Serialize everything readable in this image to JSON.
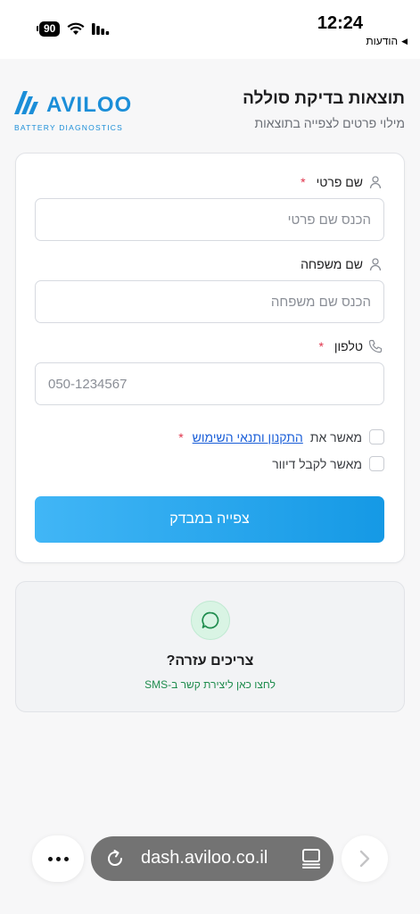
{
  "status_bar": {
    "time": "12:24",
    "back_app": "הודעות",
    "battery": "90"
  },
  "header": {
    "title": "תוצאות בדיקת סוללה",
    "subtitle": "מילוי פרטים לצפייה בתוצאות",
    "logo": {
      "word": "AVILOO",
      "tagline": "BATTERY DIAGNOSTICS"
    }
  },
  "form": {
    "first_name": {
      "label": "שם פרטי",
      "required_mark": "*",
      "placeholder": "הכנס שם פרטי",
      "value": ""
    },
    "last_name": {
      "label": "שם משפחה",
      "placeholder": "הכנס שם משפחה",
      "value": ""
    },
    "phone": {
      "label": "טלפון",
      "required_mark": "*",
      "placeholder": "050-1234567",
      "value": ""
    },
    "terms": {
      "prefix": "מאשר את",
      "link_text": "התקנון ותנאי השימוש",
      "required_mark": "*",
      "checked": false
    },
    "newsletter": {
      "label": "מאשר לקבל דיוור",
      "checked": false
    },
    "submit_label": "צפייה במבדק"
  },
  "help": {
    "title": "צריכים עזרה?",
    "subtitle": "לחצו כאן ליצירת קשר ב-SMS"
  },
  "browser": {
    "url": "dash.aviloo.co.il"
  },
  "colors": {
    "brand": "#1b8ed8",
    "button_start": "#41b6f6",
    "button_end": "#1599e5",
    "required": "#e0334b",
    "help_green": "#1f8c4e"
  },
  "icons": {
    "first_name": "user-icon",
    "last_name": "user-icon",
    "phone": "phone-icon",
    "help": "chat-bubble-icon"
  }
}
